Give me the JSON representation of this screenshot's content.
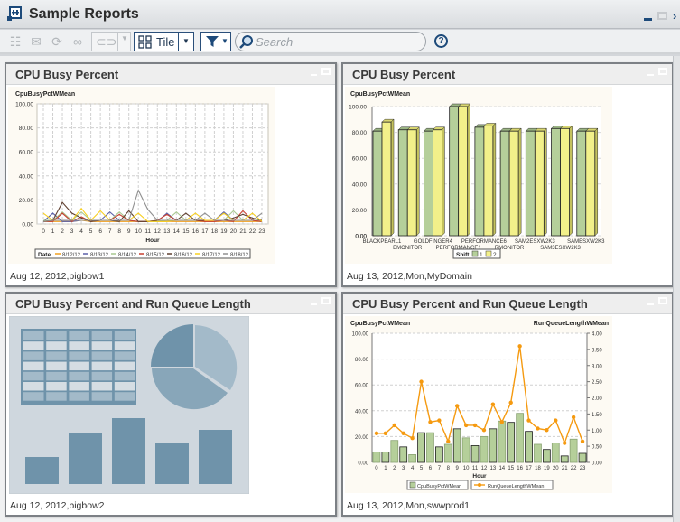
{
  "window": {
    "title": "Sample Reports",
    "icons": [
      "report-app-icon",
      "minimize-icon",
      "maximize-icon",
      "more-icon"
    ]
  },
  "toolbar": {
    "icons": [
      "list-icon",
      "email-icon",
      "refresh-icon",
      "glasses-icon",
      "link-icon"
    ],
    "view_label": "Tile",
    "search_placeholder": "Search",
    "help_label": "?"
  },
  "tiles": [
    {
      "title": "CPU Busy Percent",
      "footer": "Aug 12, 2012,bigbow1",
      "chart_kind": "line"
    },
    {
      "title": "CPU Busy Percent",
      "footer": "Aug 13, 2012,Mon,MyDomain",
      "chart_kind": "bar"
    },
    {
      "title": "CPU Busy Percent and Run Queue Length",
      "footer": "Aug 12, 2012,bigbow2",
      "chart_kind": "placeholder"
    },
    {
      "title": "CPU Busy Percent and Run Queue Length",
      "footer": "Aug 13, 2012,Mon,swwprod1",
      "chart_kind": "bar-line"
    }
  ],
  "chart_data": [
    {
      "type": "line",
      "title": "",
      "ylabel": "CpuBusyPctWMean",
      "xlabel": "Hour",
      "ylim": [
        0,
        100
      ],
      "yticks": [
        "0.00",
        "20.00",
        "40.00",
        "60.00",
        "80.00",
        "100.00"
      ],
      "x": [
        0,
        1,
        2,
        3,
        4,
        5,
        6,
        7,
        8,
        9,
        10,
        11,
        12,
        13,
        14,
        15,
        16,
        17,
        18,
        19,
        20,
        21,
        22,
        23
      ],
      "legend_title": "Date",
      "series": [
        {
          "name": "8/12/12",
          "color": "#f0a020",
          "values": [
            2,
            2,
            2,
            2,
            3,
            2,
            2,
            2,
            2,
            2,
            2,
            2,
            2,
            2,
            2,
            2,
            2,
            2,
            2,
            2,
            2,
            2,
            2,
            2
          ]
        },
        {
          "name": "8/13/12",
          "color": "#5a5fa8",
          "values": [
            2,
            9,
            2,
            2,
            3,
            3,
            3,
            10,
            3,
            3,
            2,
            2,
            2,
            9,
            3,
            3,
            3,
            3,
            3,
            10,
            3,
            3,
            3,
            2
          ]
        },
        {
          "name": "8/14/12",
          "color": "#a8c890",
          "values": [
            3,
            3,
            10,
            3,
            10,
            3,
            3,
            3,
            10,
            3,
            2,
            2,
            2,
            3,
            10,
            3,
            3,
            3,
            3,
            3,
            11,
            3,
            3,
            3
          ]
        },
        {
          "name": "8/15/12",
          "color": "#c84030",
          "values": [
            2,
            2,
            9,
            2,
            6,
            2,
            3,
            3,
            8,
            3,
            2,
            2,
            3,
            8,
            3,
            3,
            3,
            2,
            2,
            3,
            2,
            11,
            3,
            2
          ]
        },
        {
          "name": "8/16/12",
          "color": "#604030",
          "values": [
            2,
            3,
            18,
            9,
            5,
            2,
            3,
            3,
            2,
            11,
            2,
            2,
            3,
            3,
            3,
            9,
            3,
            3,
            3,
            3,
            5,
            8,
            5,
            3
          ]
        },
        {
          "name": "8/17/12",
          "color": "#f8d020",
          "values": [
            9,
            3,
            3,
            3,
            13,
            3,
            11,
            3,
            3,
            3,
            9,
            2,
            2,
            2,
            3,
            3,
            9,
            3,
            3,
            9,
            3,
            3,
            9,
            2
          ]
        },
        {
          "name": "8/18/12",
          "color": "#909090",
          "values": [
            2,
            3,
            3,
            3,
            3,
            3,
            3,
            3,
            3,
            3,
            28,
            12,
            3,
            3,
            3,
            3,
            3,
            9,
            3,
            3,
            3,
            3,
            3,
            9
          ]
        }
      ]
    },
    {
      "type": "bar",
      "ylabel": "CpuBusyPctWMean",
      "ylim": [
        0,
        100
      ],
      "yticks": [
        "0.00",
        "20.00",
        "40.00",
        "60.00",
        "80.00",
        "100.00"
      ],
      "categories": [
        "BLACKPEARL1",
        "EMONITOR",
        "GOLDFINGER4",
        "PERFORMANCE1",
        "PERFORMANCE6",
        "RMONITOR",
        "SAM2ESXW2K3",
        "SAM3ESXW2K3",
        "SAMESXW2K3"
      ],
      "legend_title": "Shift",
      "series": [
        {
          "name": "1",
          "color": "#b5cf9a",
          "values": [
            81,
            82,
            81,
            100,
            84,
            81,
            81,
            83,
            81
          ]
        },
        {
          "name": "2",
          "color": "#f2f08a",
          "values": [
            88,
            82,
            82,
            100,
            85,
            81,
            81,
            83,
            81
          ]
        }
      ]
    },
    {
      "type": "bar",
      "ylabel": "CpuBusyPctWMean",
      "y2label": "RunQueueLengthWMean",
      "xlabel": "Hour",
      "ylim": [
        0,
        100
      ],
      "y2lim": [
        0,
        4
      ],
      "yticks": [
        "0.00",
        "20.00",
        "40.00",
        "60.00",
        "80.00",
        "100.00"
      ],
      "y2ticks": [
        "0.00",
        "0.50",
        "1.00",
        "1.50",
        "2.00",
        "2.50",
        "3.00",
        "3.50",
        "4.00"
      ],
      "categories": [
        "0",
        "1",
        "2",
        "3",
        "4",
        "5",
        "6",
        "7",
        "8",
        "9",
        "10",
        "11",
        "12",
        "13",
        "14",
        "15",
        "16",
        "17",
        "18",
        "19",
        "20",
        "21",
        "22",
        "23"
      ],
      "series": [
        {
          "name": "CpuBusyPctWMean",
          "type": "bar",
          "color": "#b5cf9a",
          "values": [
            8,
            8,
            17,
            12,
            6,
            23,
            23,
            12,
            14,
            26,
            19,
            13,
            20,
            26,
            32,
            31,
            38,
            24,
            14,
            10,
            15,
            5,
            18,
            7
          ]
        },
        {
          "name": "RunQueueLengthWMean",
          "type": "line",
          "axis": "right",
          "color": "#f59a10",
          "values": [
            0.9,
            0.9,
            1.15,
            0.9,
            0.75,
            2.5,
            1.25,
            1.3,
            0.65,
            1.75,
            1.15,
            1.15,
            1.0,
            1.8,
            1.25,
            1.85,
            3.6,
            1.3,
            1.05,
            1.0,
            1.3,
            0.6,
            1.4,
            0.65
          ]
        }
      ]
    }
  ]
}
